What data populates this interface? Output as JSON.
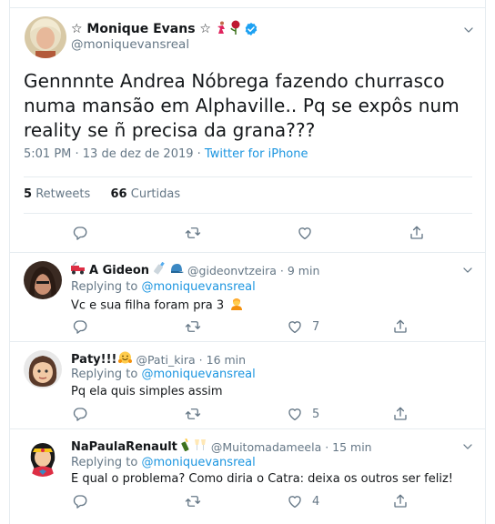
{
  "main_tweet": {
    "display_name": "☆ Monique Evans ☆",
    "handle": "@moniquevansreal",
    "text": "Gennnnte Andrea Nóbrega fazendo churrasco numa mansão em Alphaville.. Pq se expôs num reality se ñ precisa da grana???",
    "time": "5:01 PM · 13 de dez de 2019 · ",
    "source": "Twitter for iPhone",
    "retweets_count": "5",
    "retweets_label": "Retweets",
    "likes_count": "66",
    "likes_label": "Curtidas"
  },
  "replies": [
    {
      "display_name": "A Gideon",
      "handle": "@gideonvtzeira · 9 min",
      "replying_label": "Replying to",
      "replying_handle": "@moniquevansreal",
      "text": "Vc e sua filha foram pra 3",
      "likes": "7"
    },
    {
      "display_name": "Paty!!!",
      "handle": "@Pati_kira · 16 min",
      "replying_label": "Replying to",
      "replying_handle": "@moniquevansreal",
      "text": "Pq ela quis simples assim",
      "likes": "5"
    },
    {
      "display_name": "NaPaulaRenault",
      "handle": "@Muitomadameela · 15 min",
      "replying_label": "Replying to",
      "replying_handle": "@moniquevansreal",
      "text": "E qual o problema? Como diria o Catra: deixa os outros ser feliz!",
      "likes": "4"
    }
  ],
  "icons": [
    "reply-icon",
    "retweet-icon",
    "like-icon",
    "share-icon",
    "chevron-down-icon",
    "verified-icon"
  ],
  "colors": {
    "link": "#1b95e0",
    "muted": "#657786",
    "text": "#14171a",
    "border": "#e6ecf0"
  }
}
